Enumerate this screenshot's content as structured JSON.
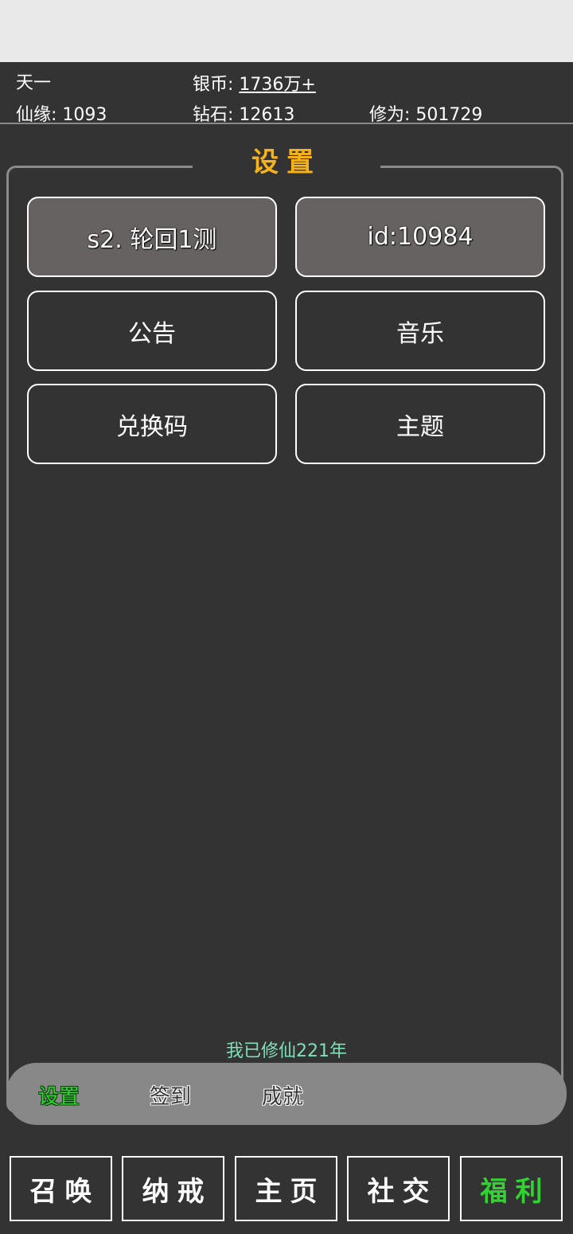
{
  "player": {
    "name": "天一",
    "silver_label": "银币: ",
    "silver_value": "1736万+",
    "xianyuan": "仙缘: 1093",
    "diamond": "钻石: 12613",
    "xiuwei": "修为: 501729"
  },
  "panel": {
    "title": "设置",
    "buttons": [
      {
        "label": "s2. 轮回1测"
      },
      {
        "label": "id:10984"
      },
      {
        "label": "公告"
      },
      {
        "label": "音乐"
      },
      {
        "label": "兑换码"
      },
      {
        "label": "主题"
      }
    ]
  },
  "years_text": "我已修仙221年",
  "subtabs": [
    {
      "label": "设置",
      "active": true
    },
    {
      "label": "签到"
    },
    {
      "label": "成就"
    }
  ],
  "bottom_nav": [
    {
      "label": "召唤"
    },
    {
      "label": "纳戒"
    },
    {
      "label": "主页"
    },
    {
      "label": "社交"
    },
    {
      "label": "福利",
      "active": true
    }
  ],
  "colors": {
    "accent_title": "#f5b21b",
    "active_green": "#2fd42f",
    "years_text": "#7fe0b8",
    "background": "#333333"
  }
}
